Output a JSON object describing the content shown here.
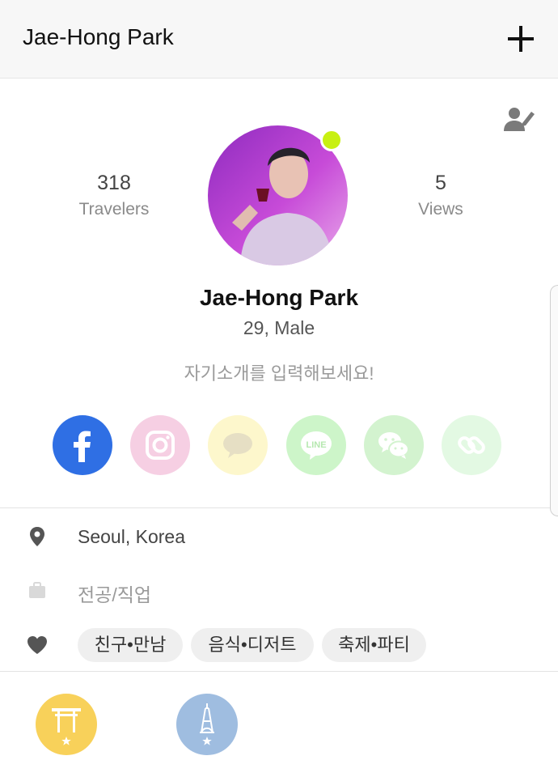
{
  "header": {
    "title": "Jae-Hong Park",
    "add_icon": "plus-icon"
  },
  "profile": {
    "edit_icon": "edit-profile-icon",
    "stats": {
      "travelers_count": "318",
      "travelers_label": "Travelers",
      "views_count": "5",
      "views_label": "Views"
    },
    "online_status_color": "#c8f012",
    "name": "Jae-Hong Park",
    "age_sex": "29, Male",
    "intro_placeholder": "자기소개를 입력해보세요!"
  },
  "social_links": [
    {
      "name": "facebook",
      "icon": "facebook-icon",
      "color": "#2f6fe4"
    },
    {
      "name": "instagram",
      "icon": "instagram-icon",
      "color": "#f6cfe3"
    },
    {
      "name": "kakaotalk",
      "icon": "speech-bubble-icon",
      "color": "#fdf7cc"
    },
    {
      "name": "line",
      "icon": "line-icon",
      "color": "#cdf5c9",
      "text": "LINE"
    },
    {
      "name": "wechat",
      "icon": "wechat-icon",
      "color": "#d3f3cf"
    },
    {
      "name": "link",
      "icon": "link-icon",
      "color": "#e3f9e3"
    }
  ],
  "details": {
    "location_icon": "location-pin-icon",
    "location": "Seoul, Korea",
    "job_icon": "briefcase-icon",
    "job_placeholder": "전공/직업",
    "interests_icon": "heart-icon",
    "interests": [
      "친구•만남",
      "음식•디저트",
      "축제•파티"
    ]
  },
  "badges": [
    {
      "icon": "torii-gate-icon",
      "color": "#f8d15a"
    },
    {
      "icon": "eiffel-tower-icon",
      "color": "#9fbde0"
    }
  ]
}
